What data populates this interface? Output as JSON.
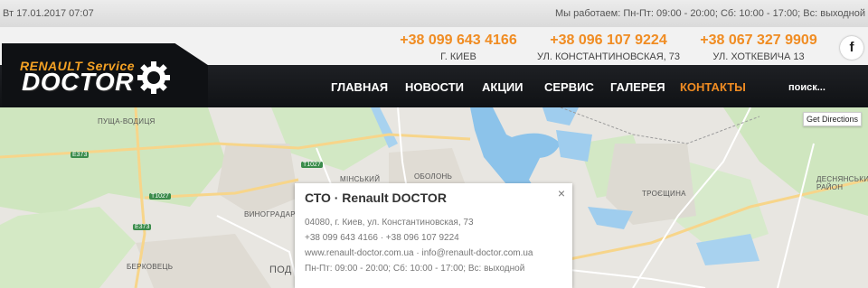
{
  "topbar": {
    "date": "Вт 17.01.2017 07:07",
    "hours": "Мы работаем: Пн-Пт: 09:00 - 20:00; Сб: 10:00 - 17:00; Вс: выходной"
  },
  "contacts": [
    {
      "phone": "+38 099 643 4166",
      "address": "Г. КИЕВ"
    },
    {
      "phone": "+38 096 107 9224",
      "address": "УЛ. КОНСТАНТИНОВСКАЯ, 73"
    },
    {
      "phone": "+38 067 327 9909",
      "address": "УЛ. ХОТКЕВИЧА 13"
    }
  ],
  "social": {
    "facebook": "f"
  },
  "logo": {
    "line1": "RENAULT Service",
    "line2": "DOCTOR"
  },
  "nav": {
    "items": [
      "ГЛАВНАЯ",
      "НОВОСТИ",
      "АКЦИИ",
      "СЕРВИС",
      "ГАЛЕРЕЯ",
      "КОНТАКТЫ"
    ],
    "active": "КОНТАКТЫ",
    "search_placeholder": "поиск..."
  },
  "map": {
    "get_directions": "Get Directions",
    "labels": {
      "pushcha": "ПУЩА-ВОДИЦЯ",
      "minsky": "МІНСЬКИЙ",
      "obolon": "ОБОЛОНЬ",
      "vynogradar": "ВИНОГРАДАР",
      "berkovets": "БЕРКОВЕЦЬ",
      "pod": "ПОД",
      "troieshchyna": "ТРОЄЩИНА",
      "desnianskyi": "ДЕСНЯНСЬКИЙ РАЙОН"
    },
    "roads": [
      "E373",
      "T1027",
      "T1027",
      "E373"
    ],
    "popup": {
      "title": "СТО · Renault DOCTOR",
      "close": "×",
      "address": "04080, г. Киев, ул. Константиновская, 73",
      "phones": "+38 099 643 4166 · +38 096 107 9224",
      "web": "www.renault-doctor.com.ua · info@renault-doctor.com.ua",
      "hours": "Пн-Пт: 09:00 - 20:00; Сб: 10:00 - 17:00; Вс: выходной"
    }
  },
  "colors": {
    "accent": "#f08c22",
    "nav_bg": "#16181b",
    "water": "#8cc3ea",
    "green": "#cfe6bf"
  }
}
